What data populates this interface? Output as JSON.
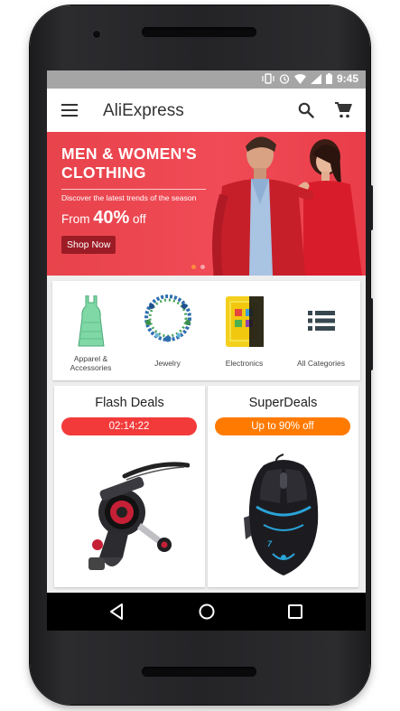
{
  "status_bar": {
    "time": "9:45"
  },
  "app_bar": {
    "title": "AliExpress"
  },
  "banner": {
    "title_line1": "MEN & WOMEN'S",
    "title_line2": "CLOTHING",
    "subtitle": "Discover the latest trends of the season",
    "offer_prefix": "From ",
    "offer_value": "40%",
    "offer_suffix": " off",
    "cta": "Shop Now",
    "active_slide": 1,
    "slide_count": 2
  },
  "categories": [
    {
      "label_line1": "Apparel &",
      "label_line2": "Accessories",
      "icon": "dress-icon"
    },
    {
      "label": "Jewelry",
      "icon": "necklace-icon"
    },
    {
      "label": "Electronics",
      "icon": "smartphone-icon"
    },
    {
      "label": "All Categories",
      "icon": "list-icon"
    }
  ],
  "deals": [
    {
      "title": "Flash Deals",
      "badge": "02:14:22",
      "badge_color": "#f23a3a",
      "image": "fishing-reel"
    },
    {
      "title": "SuperDeals",
      "badge": "Up to 90% off",
      "badge_color": "#ff7a00",
      "image": "gaming-mouse"
    }
  ],
  "colors": {
    "brand_red": "#e8434c",
    "accent_orange": "#ff7a00",
    "status_bar": "#a5a5a5"
  }
}
